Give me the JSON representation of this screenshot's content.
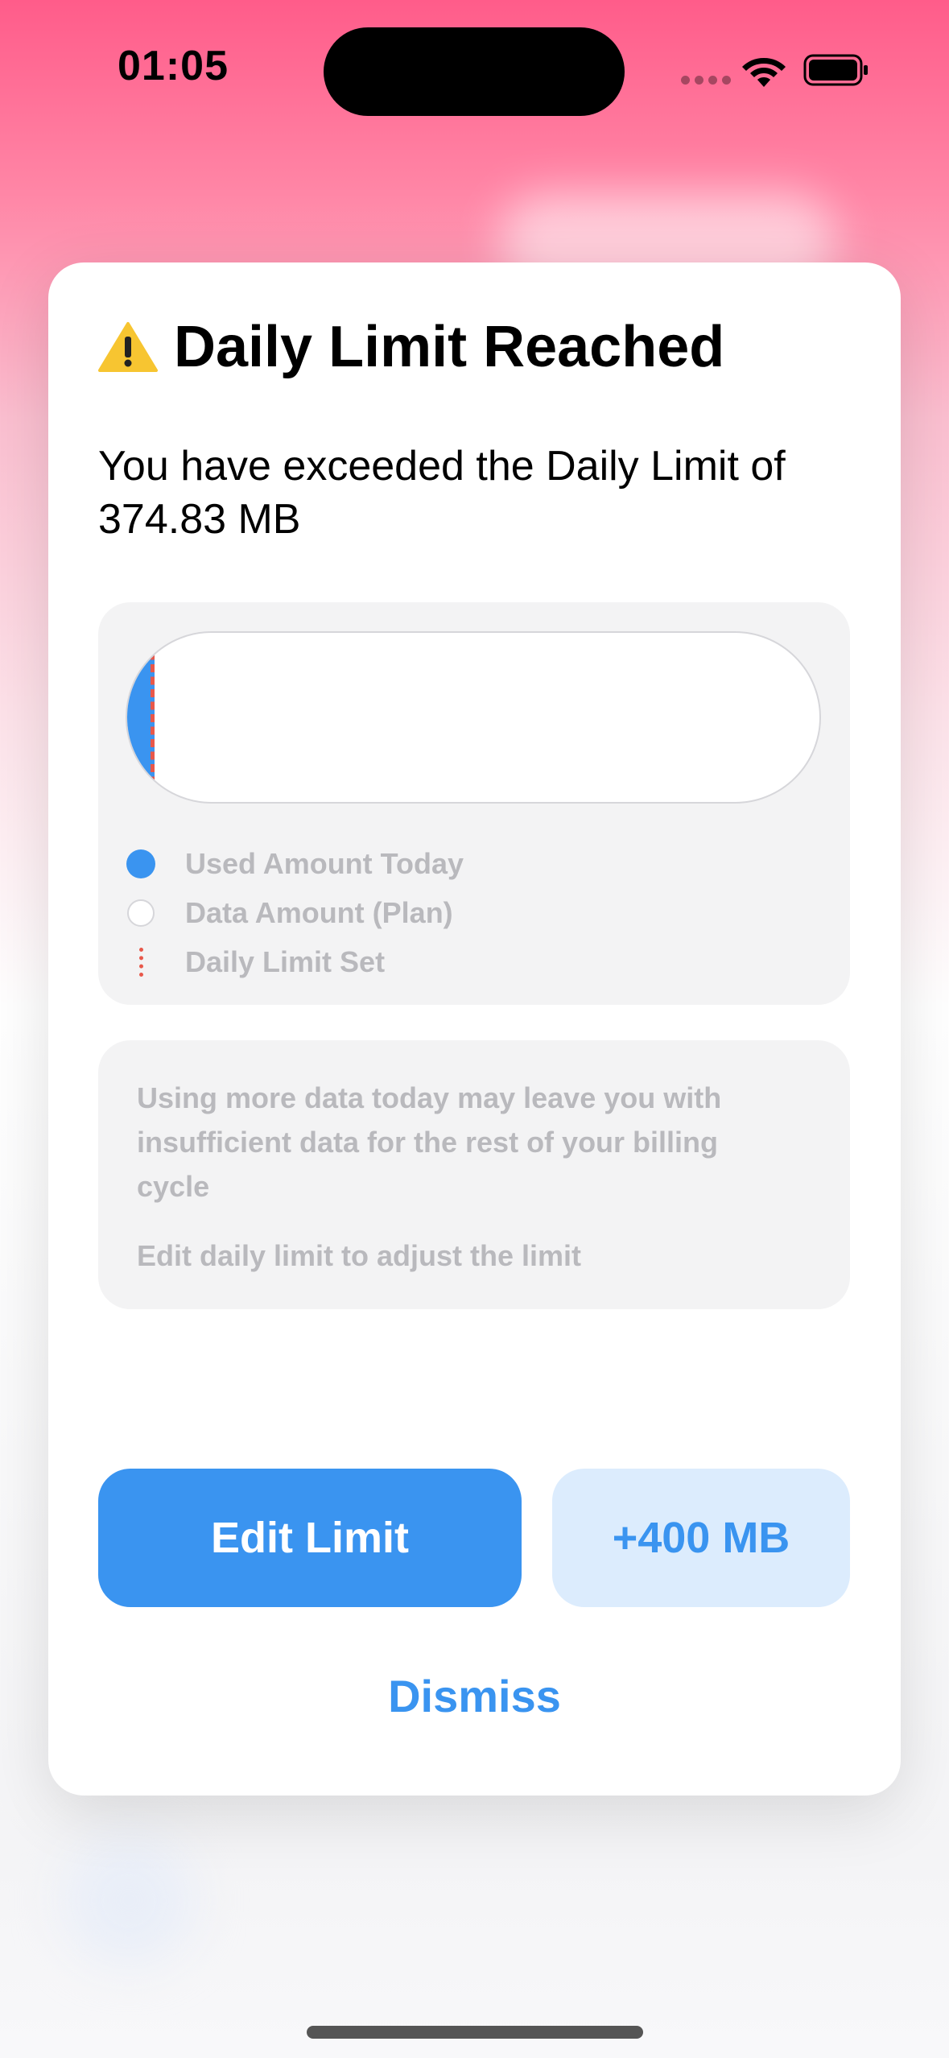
{
  "status_bar": {
    "time": "01:05",
    "icons": [
      "signal-icon",
      "wifi-icon",
      "battery-icon"
    ]
  },
  "dialog": {
    "icon": "warning-icon",
    "title": "Daily Limit Reached",
    "message": "You have exceeded the Daily Limit of 374.83 MB",
    "usage_bar": {
      "used_fraction": 0.04,
      "limit_fraction": 0.04
    },
    "legend": [
      {
        "label": "Used Amount Today"
      },
      {
        "label": "Data Amount (Plan)"
      },
      {
        "label": "Daily Limit Set"
      }
    ],
    "info": {
      "line1": "Using more data today may leave you with insufficient data for the rest of your billing cycle",
      "line2": "Edit daily limit to adjust the limit"
    },
    "buttons": {
      "edit": "Edit Limit",
      "add": "+400 MB",
      "dismiss": "Dismiss"
    }
  },
  "colors": {
    "accent": "#3a94f0",
    "limit_line": "#e8584a",
    "add_button_bg": "#dcecfd",
    "header_gradient_top": "#ff5c8a"
  }
}
